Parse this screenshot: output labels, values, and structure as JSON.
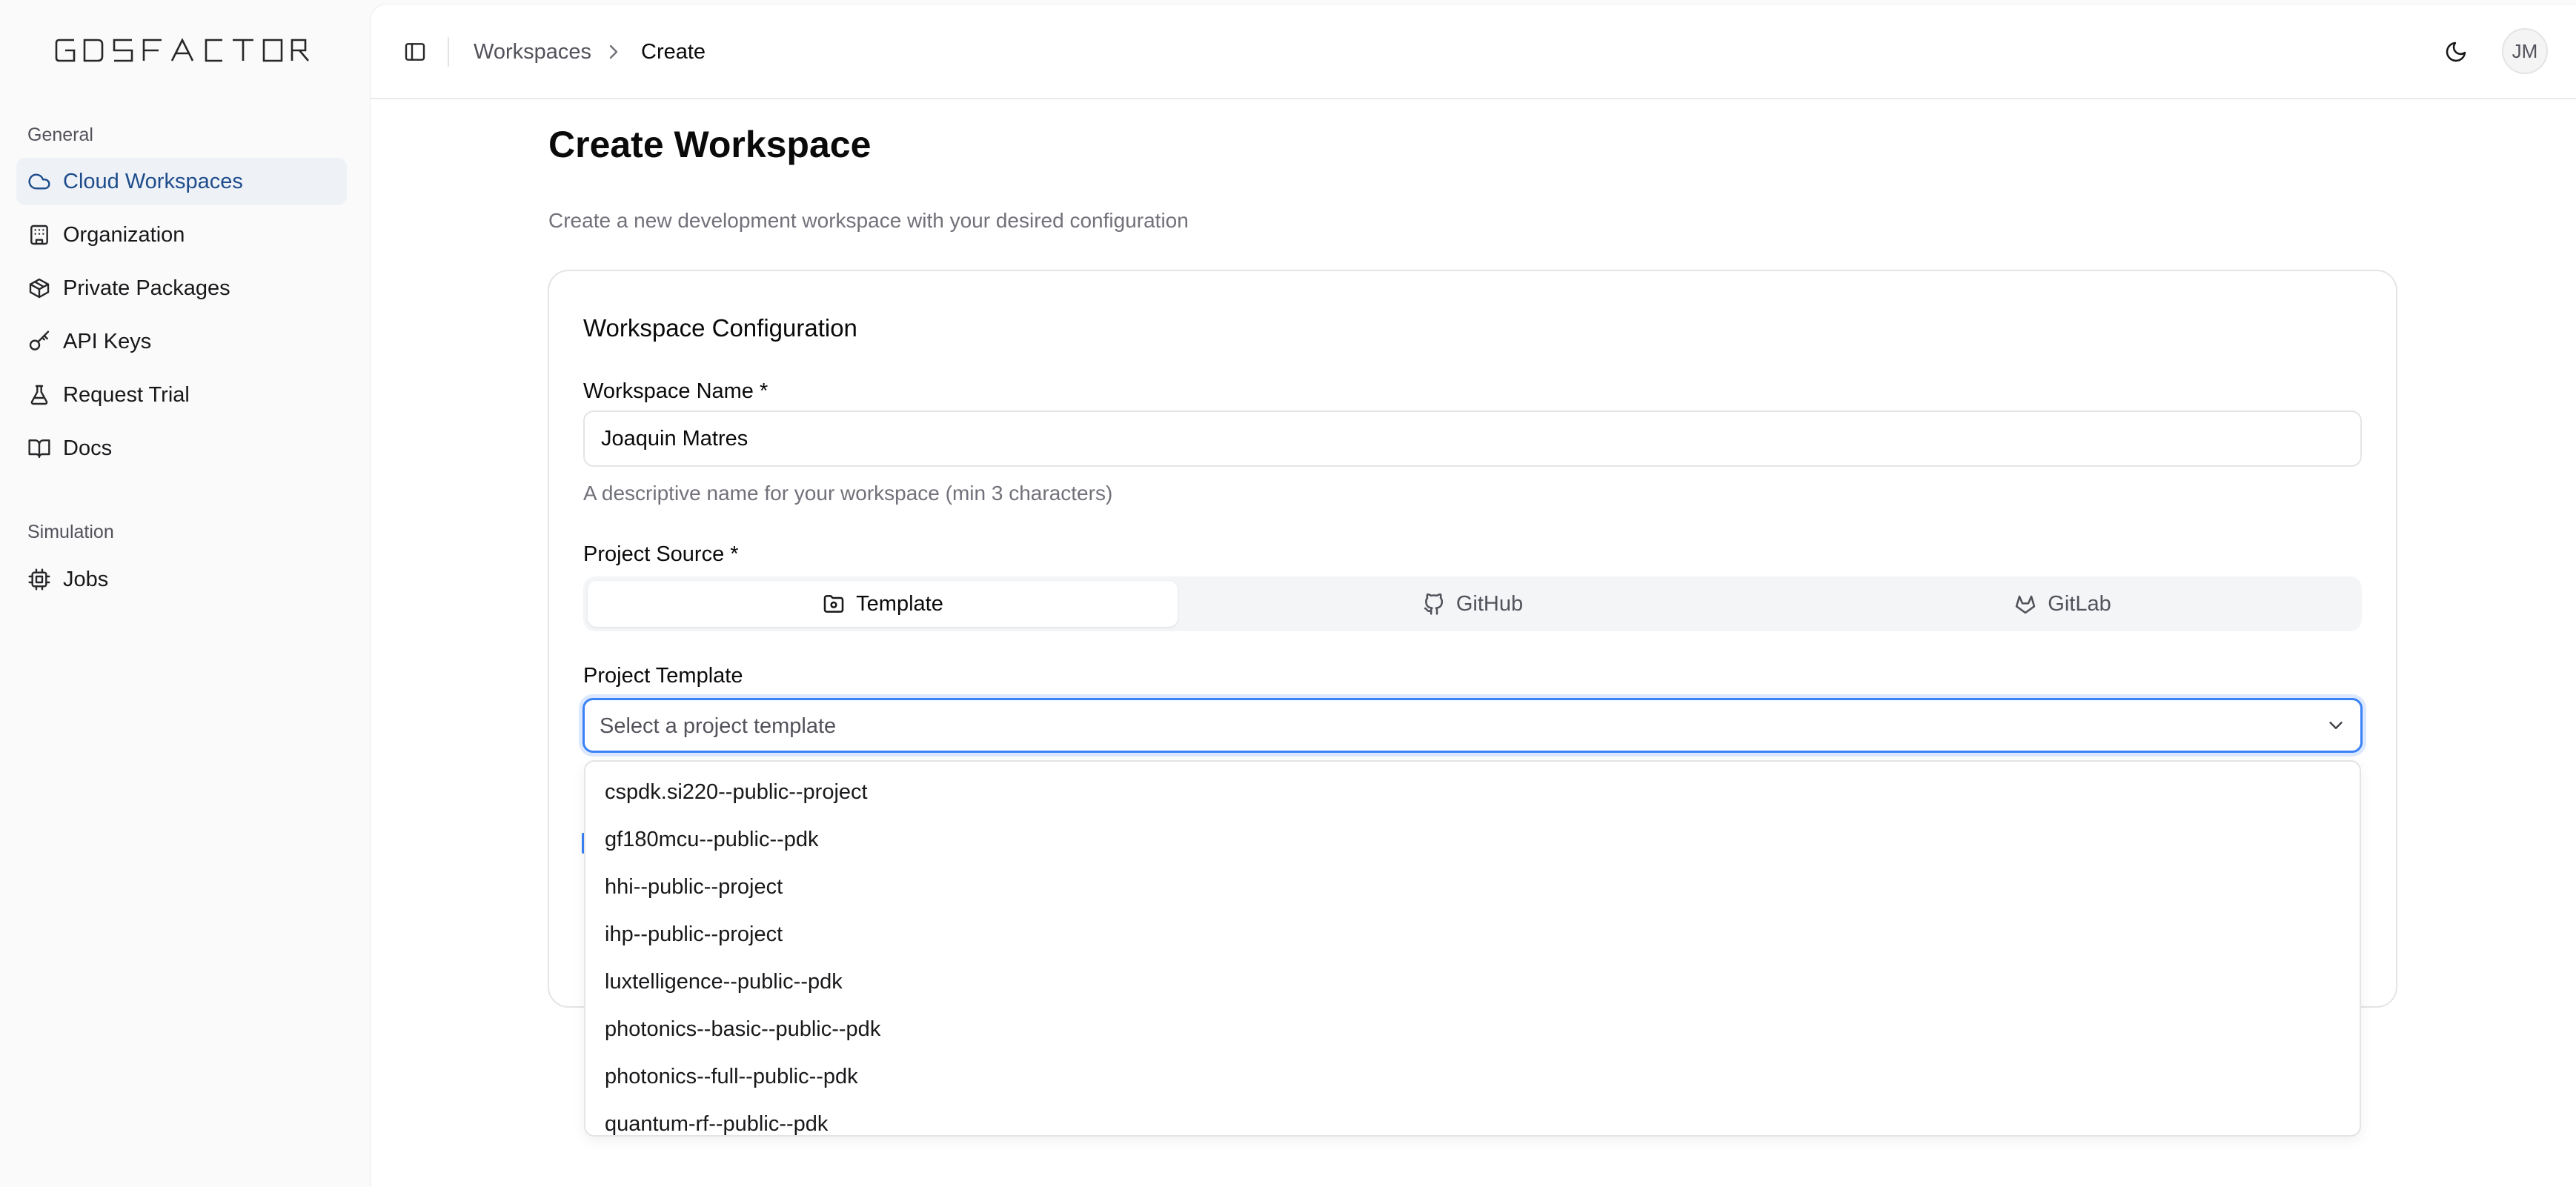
{
  "sidebar": {
    "logo_text": "GDSFACTORY",
    "groups": [
      {
        "label": "General",
        "items": [
          {
            "label": "Cloud Workspaces",
            "icon": "cloud-icon",
            "active": true
          },
          {
            "label": "Organization",
            "icon": "building-icon"
          },
          {
            "label": "Private Packages",
            "icon": "package-icon"
          },
          {
            "label": "API Keys",
            "icon": "key-icon"
          },
          {
            "label": "Request Trial",
            "icon": "flask-icon"
          },
          {
            "label": "Docs",
            "icon": "book-open-icon"
          }
        ]
      },
      {
        "label": "Simulation",
        "items": [
          {
            "label": "Jobs",
            "icon": "cpu-icon"
          }
        ]
      }
    ]
  },
  "header": {
    "toggle_icon": "sidebar-toggle-icon",
    "breadcrumbs": [
      "Workspaces",
      "Create"
    ],
    "theme_icon": "moon-icon",
    "avatar_initials": "JM"
  },
  "page": {
    "title": "Create Workspace",
    "subtitle": "Create a new development workspace with your desired configuration"
  },
  "form": {
    "card_title": "Workspace Configuration",
    "name_label": "Workspace Name *",
    "name_value": "Joaquin Matres",
    "name_help": "A descriptive name for your workspace (min 3 characters)",
    "source_label": "Project Source *",
    "source_tabs": [
      {
        "label": "Template",
        "icon": "folder-icon",
        "active": true
      },
      {
        "label": "GitHub",
        "icon": "github-icon"
      },
      {
        "label": "GitLab",
        "icon": "gitlab-icon"
      }
    ],
    "template_label": "Project Template",
    "template_placeholder": "Select a project template",
    "template_options": [
      "cspdk.si220--public--project",
      "gf180mcu--public--pdk",
      "hhi--public--project",
      "ihp--public--project",
      "luxtelligence--public--pdk",
      "photonics--basic--public--pdk",
      "photonics--full--public--pdk",
      "quantum-rf--public--pdk"
    ]
  },
  "colors": {
    "accent": "#1e4c8c",
    "focus_ring": "#3b82f6",
    "active_nav_bg": "#eef2f7"
  }
}
